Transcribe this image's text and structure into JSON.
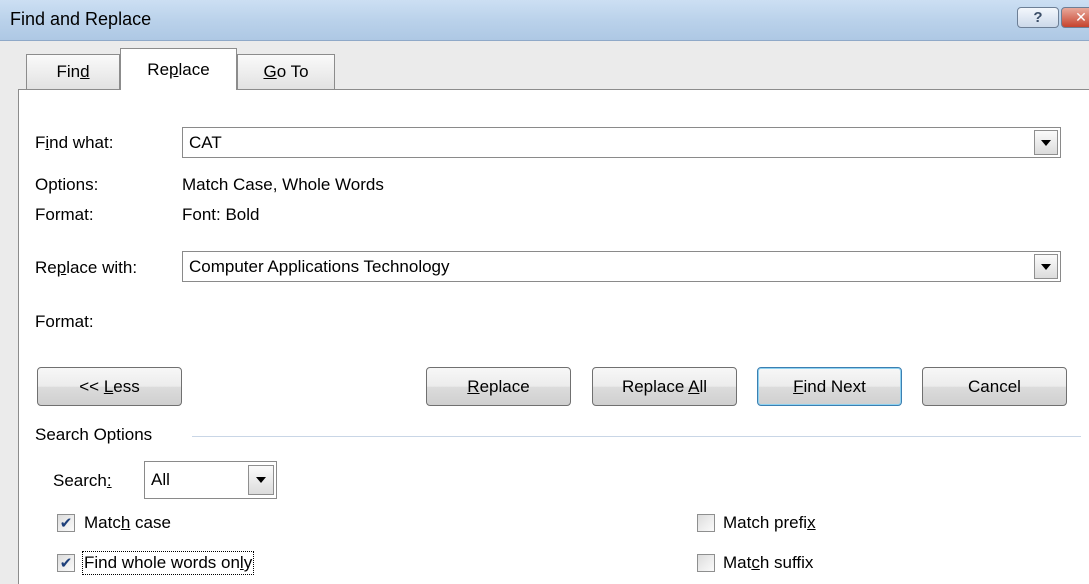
{
  "window": {
    "title": "Find and Replace",
    "help_glyph": "?",
    "close_glyph": "✕"
  },
  "tabs": [
    {
      "label": "Find",
      "mnemonic_index": 3,
      "active": false
    },
    {
      "label": "Replace",
      "mnemonic_index": 2,
      "active": true
    },
    {
      "label": "Go To",
      "mnemonic_index": 0,
      "active": false
    }
  ],
  "find": {
    "label": "Find what:",
    "label_mnemonic_index": 1,
    "value": "CAT",
    "options_label": "Options:",
    "options_value": "Match Case, Whole Words",
    "format_label": "Format:",
    "format_value": "Font: Bold"
  },
  "replace": {
    "label": "Replace with:",
    "label_mnemonic_index": 2,
    "value": "Computer Applications Technology",
    "format_label": "Format:",
    "format_value": ""
  },
  "buttons": {
    "less": {
      "label": "<< Less",
      "mnemonic_index": 3
    },
    "replace": {
      "label": "Replace",
      "mnemonic_index": 0
    },
    "replace_all": {
      "label": "Replace All",
      "mnemonic_index": 8
    },
    "find_next": {
      "label": "Find Next",
      "mnemonic_index": 0
    },
    "cancel": {
      "label": "Cancel"
    }
  },
  "search_options": {
    "heading": "Search Options",
    "search_label": "Search:",
    "search_label_mnemonic_index": 6,
    "search_value": "All",
    "match_case": {
      "label": "Match case",
      "mnemonic_index": 4,
      "checked": true
    },
    "whole_words": {
      "label": "Find whole words only",
      "mnemonic_index": 19,
      "checked": true
    },
    "match_prefix": {
      "label": "Match prefix",
      "mnemonic_index": 11,
      "checked": false
    },
    "match_suffix": {
      "label": "Match suffix",
      "mnemonic_index": 3,
      "checked": false
    }
  },
  "colors": {
    "title_bar": "#b9d1ea",
    "dialog_bg": "#ebebeb",
    "default_button_border": "#3c7fb1",
    "close_button": "#c6432d"
  },
  "icons": {
    "dropdown": "triangle-down",
    "checkmark": "✔"
  }
}
